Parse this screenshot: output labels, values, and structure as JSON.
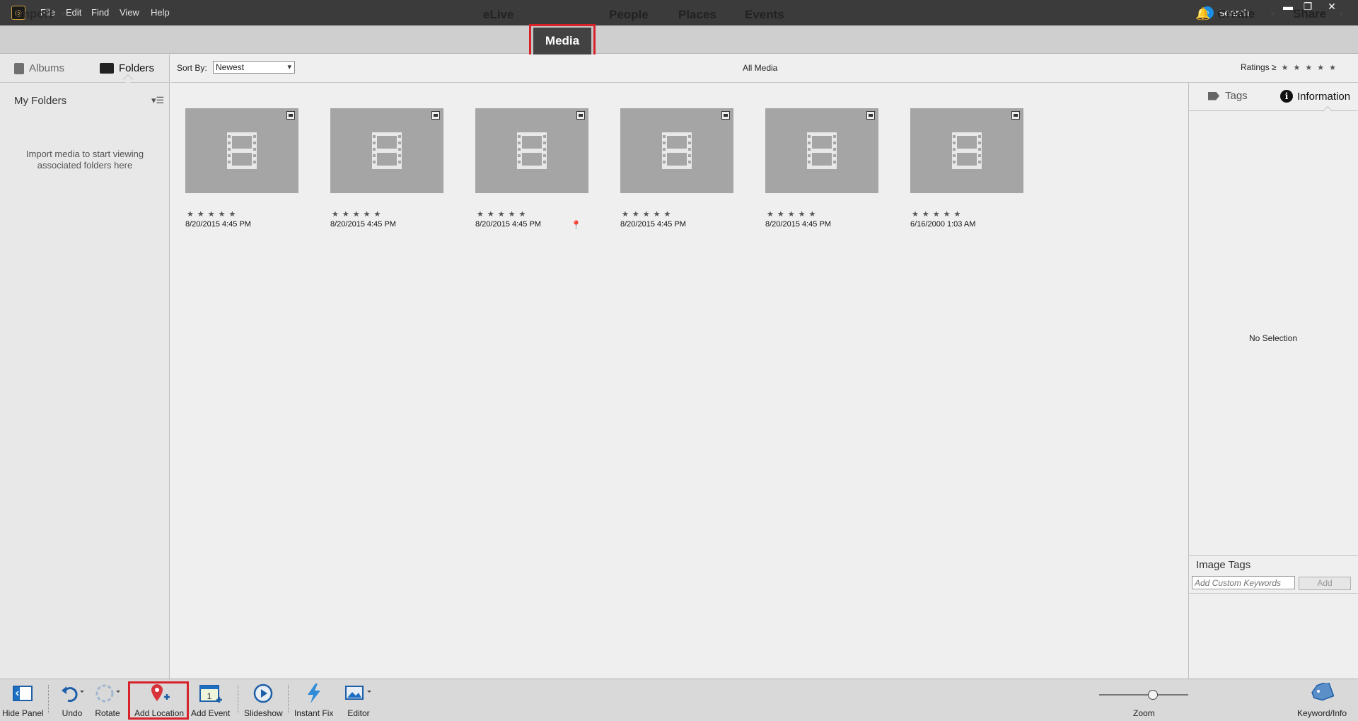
{
  "menu": [
    "File",
    "Edit",
    "Find",
    "View",
    "Help"
  ],
  "search_label": "Search",
  "nav": {
    "import": "Import",
    "tabs": [
      "eLive",
      "Media",
      "People",
      "Places",
      "Events"
    ],
    "active_tab": "Media",
    "create": "Create",
    "share": "Share"
  },
  "left_panel": {
    "albums": "Albums",
    "folders": "Folders",
    "my_folders": "My Folders",
    "empty_msg": "Import media to start viewing associated folders here"
  },
  "sort": {
    "label": "Sort By:",
    "value": "Newest"
  },
  "view_title": "All Media",
  "ratings_label": "Ratings ≥",
  "media": [
    {
      "date": "8/20/2015 4:45 PM",
      "stars": "★★★★★",
      "has_location": false
    },
    {
      "date": "8/20/2015 4:45 PM",
      "stars": "★★★★★",
      "has_location": false
    },
    {
      "date": "8/20/2015 4:45 PM",
      "stars": "★★★★★",
      "has_location": true
    },
    {
      "date": "8/20/2015 4:45 PM",
      "stars": "★★★★★",
      "has_location": false
    },
    {
      "date": "8/20/2015 4:45 PM",
      "stars": "★★★★★",
      "has_location": false
    },
    {
      "date": "6/16/2000 1:03 AM",
      "stars": "★★★★★",
      "has_location": false
    }
  ],
  "right_panel": {
    "tags": "Tags",
    "information": "Information",
    "no_selection": "No Selection",
    "image_tags": "Image Tags",
    "keyword_placeholder": "Add Custom Keywords",
    "add": "Add"
  },
  "toolbar": {
    "hide_panel": "Hide Panel",
    "undo": "Undo",
    "rotate": "Rotate",
    "add_location": "Add Location",
    "add_event": "Add Event",
    "slideshow": "Slideshow",
    "instant_fix": "Instant Fix",
    "editor": "Editor",
    "zoom": "Zoom",
    "keyword_info": "Keyword/Info",
    "zoom_level": 0.6
  },
  "colors": {
    "highlight": "#d8222a",
    "accent": "#1a8fe3"
  }
}
